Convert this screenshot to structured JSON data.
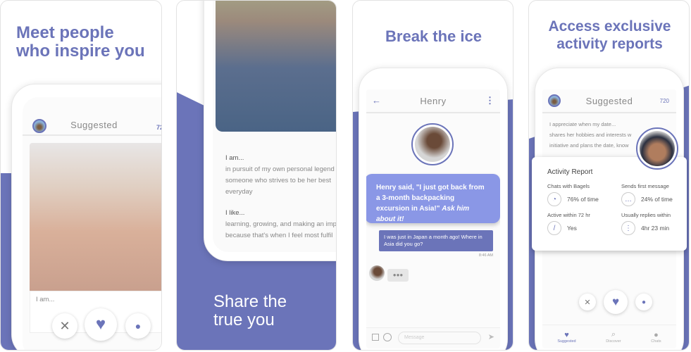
{
  "colors": {
    "accent": "#6b74b9",
    "bubble": "#8a97e6"
  },
  "panel1": {
    "headline": "Meet people who inspire you",
    "header_title": "Suggested",
    "bean_count": "72",
    "profile_prompt": "I am..."
  },
  "panel2": {
    "i_am_label": "I am...",
    "i_am_lines": [
      "in pursuit of my own personal legend",
      "someone who strives to be her best",
      "everyday"
    ],
    "i_like_label": "I like...",
    "i_like_lines": [
      "learning, growing, and making an imp",
      "because that's when I feel most fulfil"
    ],
    "headline": "Share the true you"
  },
  "panel3": {
    "headline": "Break the ice",
    "chat_name": "Henry",
    "icebreaker_quote": "Henry said, \"I just got back from a 3-month backpacking excursion in Asia!\"",
    "icebreaker_prompt": "Ask him about it!",
    "sent_message": "I was just in Japan a month ago! Where in Asia did you go?",
    "sent_time": "8:46 AM",
    "message_placeholder": "Message"
  },
  "panel4": {
    "headline": "Access exclusive activity reports",
    "header_title": "Suggested",
    "bean_count": "720",
    "bio_lines": [
      "I appreciate when my date...",
      "shares her hobbies and interests w",
      "initiative and plans the date, know"
    ],
    "report": {
      "title": "Activity Report",
      "items": [
        {
          "label": "Chats with Bagels",
          "value": "76% of time",
          "icon": "pie-chart-icon"
        },
        {
          "label": "Sends first message",
          "value": "24% of time",
          "icon": "speech-bubble-icon"
        },
        {
          "label": "Active within 72 hr",
          "value": "Yes",
          "icon": "clock-icon"
        },
        {
          "label": "Usually replies within",
          "value": "4hr 23 min",
          "icon": "progress-ring-icon"
        }
      ]
    },
    "nav": [
      {
        "label": "Suggested",
        "active": true
      },
      {
        "label": "Discover",
        "active": false
      },
      {
        "label": "Chats",
        "active": false
      }
    ]
  }
}
